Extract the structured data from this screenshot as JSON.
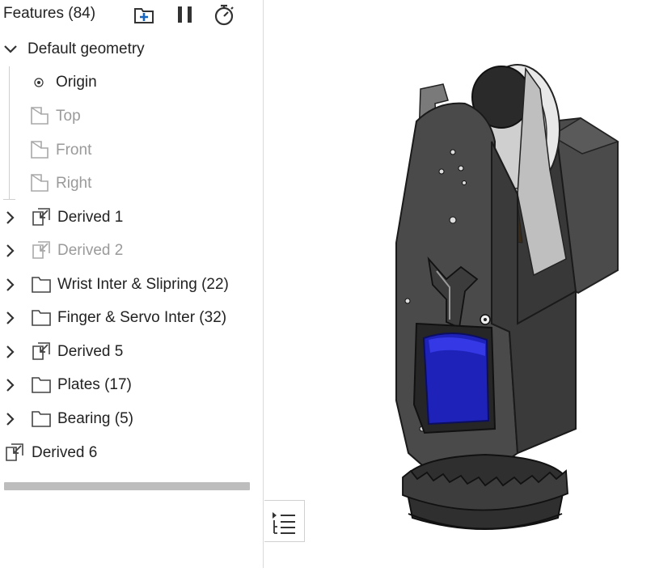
{
  "features": {
    "title": "Features (84)",
    "default_geometry": {
      "label": "Default geometry",
      "items": [
        {
          "label": "Origin"
        },
        {
          "label": "Top"
        },
        {
          "label": "Front"
        },
        {
          "label": "Right"
        }
      ]
    },
    "items": [
      {
        "label": "Derived 1"
      },
      {
        "label": "Derived 2"
      },
      {
        "label": "Wrist Inter & Slipring (22)"
      },
      {
        "label": "Finger & Servo Inter (32)"
      },
      {
        "label": "Derived 5"
      },
      {
        "label": "Plates (17)"
      },
      {
        "label": "Bearing (5)"
      },
      {
        "label": "Derived 6"
      }
    ]
  },
  "colors": {
    "accent": "#1565c0",
    "text": "#222222",
    "suppressed_text": "#9a9a9a",
    "model_body": "#3d3d3d",
    "model_plate": "#4a4a4a",
    "battery": "#1e22b8"
  },
  "icons": {
    "add_folder": "add-folder-icon",
    "pause": "pause-icon",
    "timer": "stopwatch-icon",
    "list_toggle": "list-toggle-icon"
  }
}
